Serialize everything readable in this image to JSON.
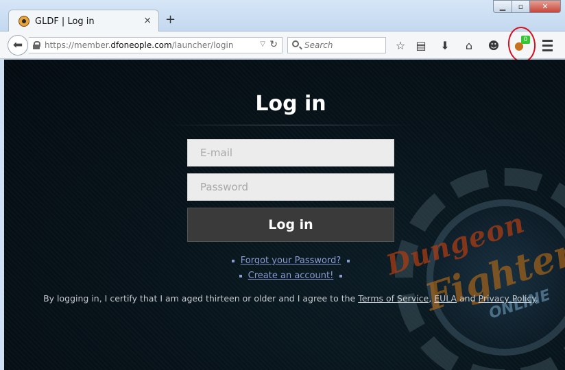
{
  "browser": {
    "tab_title": "GLDF | Log in",
    "tab_close": "×",
    "new_tab": "+",
    "url_prefix": "https://member.",
    "url_domain": "dfoneople.com",
    "url_path": "/launcher/login",
    "search_placeholder": "Search",
    "extension_badge": "0",
    "icons": [
      "back-arrow-icon",
      "lock-icon",
      "reload-icon",
      "search-icon",
      "star-icon",
      "reader-icon",
      "download-icon",
      "home-icon",
      "chat-icon",
      "extension-icon",
      "menu-icon"
    ]
  },
  "window": {
    "minimize": "▁",
    "maximize": "▫",
    "close": "✕"
  },
  "page": {
    "title": "Log in",
    "email_placeholder": "E-mail",
    "password_placeholder": "Password",
    "login_button": "Log in",
    "forgot_link": "Forgot your Password?",
    "create_link": "Create an account!",
    "legal_prefix": "By logging in, I certify that I am aged thirteen or older and I agree to the ",
    "terms_link": "Terms of Service",
    "comma": ",",
    "eula_link": "EULA",
    "and_text": " and ",
    "privacy_link": "Privacy Policy",
    "period": "."
  },
  "logo": {
    "line1": "Dungeon",
    "line2": "Fighter",
    "line3": "ONLINE"
  },
  "colors": {
    "link": "#8a9bd0",
    "page_bg": "#061118",
    "annotation_circle": "#d8101e",
    "badge": "#32c832"
  }
}
